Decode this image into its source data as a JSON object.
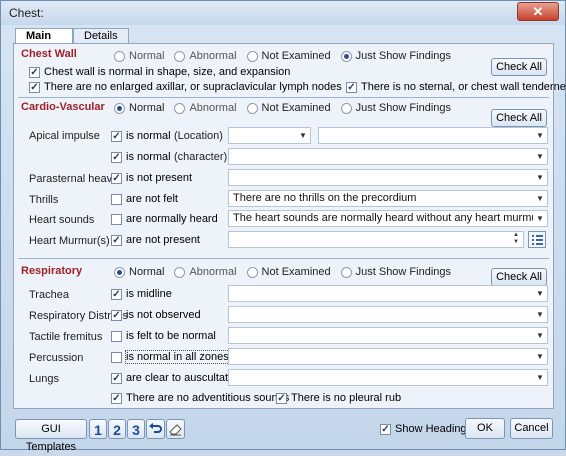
{
  "window": {
    "title": "Chest:",
    "close_glyph": "✕"
  },
  "tabs": [
    {
      "label": "Main"
    },
    {
      "label": "Details"
    }
  ],
  "chest_wall": {
    "title": "Chest Wall",
    "options": [
      "Normal",
      "Abnormal",
      "Not Examined",
      "Just Show Findings"
    ],
    "selected": "Just Show Findings",
    "check_all": "Check All",
    "findings": [
      "Chest wall is normal in shape, size, and expansion",
      "There are no enlarged axillar, or supraclavicular lymph nodes",
      "There is no sternal, or chest wall tenderness"
    ]
  },
  "cardio": {
    "title": "Cardio-Vascular",
    "options": [
      "Normal",
      "Abnormal",
      "Not Examined",
      "Just Show Findings"
    ],
    "selected": "Normal",
    "check_all": "Check All",
    "rows": [
      {
        "label": "Apical impulse",
        "check": "is normal",
        "sub": "(Location)",
        "value": "",
        "value2": ""
      },
      {
        "label": "",
        "check": "is normal",
        "sub": "(character)",
        "value": ""
      },
      {
        "label": "Parasternal heave",
        "check": "is not present",
        "value": ""
      },
      {
        "label": "Thrills",
        "check": "are not felt",
        "value": "There are no thrills on the precordium"
      },
      {
        "label": "Heart sounds",
        "check": "are normally heard",
        "value": "The heart sounds are normally heard without any heart murmurs or gallop c"
      },
      {
        "label": "Heart Murmur(s)",
        "check": "are not present",
        "value": ""
      }
    ]
  },
  "respiratory": {
    "title": "Respiratory",
    "options": [
      "Normal",
      "Abnormal",
      "Not Examined",
      "Just Show Findings"
    ],
    "selected": "Normal",
    "check_all": "Check All",
    "rows": [
      {
        "label": "Trachea",
        "check": "is midline",
        "checked": true,
        "value": ""
      },
      {
        "label": "Respiratory Distress",
        "check": "is not observed",
        "checked": true,
        "value": ""
      },
      {
        "label": "Tactile fremitus",
        "check": "is felt to be normal",
        "checked": false,
        "value": ""
      },
      {
        "label": "Percussion",
        "check": "is normal in all zones",
        "checked": false,
        "value": ""
      },
      {
        "label": "Lungs",
        "check": "are clear to auscultation",
        "checked": true,
        "value": ""
      }
    ],
    "extra": [
      "There are no adventitious sounds",
      "There is no pleural rub"
    ]
  },
  "footer": {
    "gui_templates": "GUI Templates",
    "nums": [
      "1",
      "2",
      "3"
    ],
    "show_heading": "Show Heading",
    "ok": "OK",
    "cancel": "Cancel"
  },
  "icons": {
    "dropdown": "dropdown-arrow-icon",
    "undo": "undo-icon",
    "eraser": "eraser-icon",
    "list": "list-icon"
  }
}
